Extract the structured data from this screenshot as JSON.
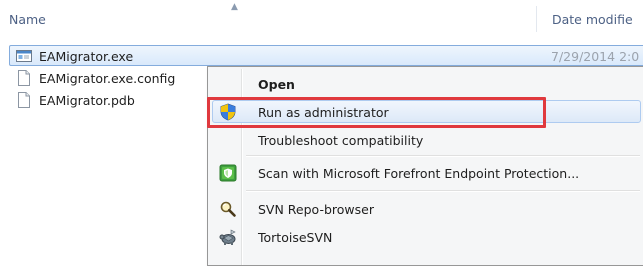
{
  "explorer": {
    "columns": {
      "name": "Name",
      "date_modified": "Date modifie"
    },
    "files": [
      {
        "name": "EAMigrator.exe",
        "date": "7/29/2014 2:0",
        "icon": "exe-icon",
        "selected": true
      },
      {
        "name": "EAMigrator.exe.config",
        "icon": "document-icon"
      },
      {
        "name": "EAMigrator.pdb",
        "icon": "document-icon"
      }
    ]
  },
  "context_menu": {
    "items": [
      {
        "label": "Open",
        "bold": true
      },
      {
        "label": "Run as administrator",
        "icon": "uac-shield-icon",
        "hovered": true
      },
      {
        "label": "Troubleshoot compatibility"
      },
      {
        "label": "Scan with Microsoft Forefront Endpoint Protection...",
        "icon": "forefront-icon"
      },
      {
        "label": "SVN Repo-browser",
        "icon": "svn-repo-browser-icon"
      },
      {
        "label": "TortoiseSVN",
        "icon": "tortoisesvn-icon"
      }
    ]
  },
  "annotation": {
    "color": "#e0393e",
    "target": "Run as administrator"
  }
}
